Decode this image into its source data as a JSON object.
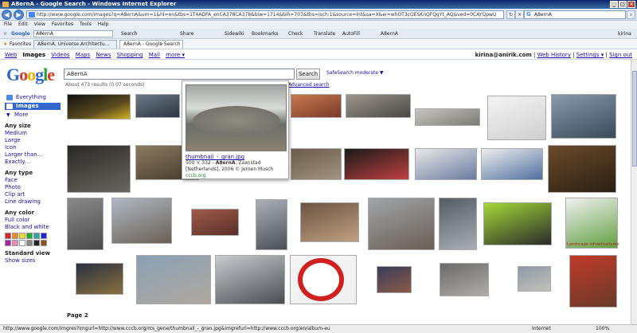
{
  "window": {
    "title": "A8ernA - Google Search - Windows Internet Explorer"
  },
  "addressbar": {
    "url": "http://www.google.com/images?q=A8ernA&um=1&hl=en&tbs=1T4ADFA_enCA378CA378&biw=1714&bih=707&tbs=isch:1&source=lnt&sa=X&ei=whOT3cOESKnQFQgYt_AQ&ved=0CAYQpwU",
    "search_value": "A8ernA",
    "search_engine": "Google"
  },
  "menu": [
    "File",
    "Edit",
    "View",
    "Favorites",
    "Tools",
    "Help"
  ],
  "toolbar": {
    "google_query": "A8ernA",
    "items": [
      "Search",
      "Share",
      "Sidewiki",
      "Bookmarks",
      "Check",
      "Translate",
      "AutoFill",
      "A8ernA"
    ],
    "account": "kirina"
  },
  "favorites": {
    "label": "Favorites",
    "tabs": [
      "A8ernA, Universe Architectu...",
      "A8ernA - Google Search"
    ]
  },
  "googlebar": {
    "left": [
      "Web",
      "Images",
      "Videos",
      "Maps",
      "News",
      "Shopping",
      "Mail",
      "more ▾"
    ],
    "current": "Images",
    "user": "kirina@anirik.com",
    "right": [
      "Web History",
      "Settings ▾",
      "Sign out"
    ]
  },
  "search": {
    "query": "A8ernA",
    "button": "Search",
    "safesearch": "SafeSearch moderate ▼",
    "stats": "About 473 results (0.07 seconds)",
    "advanced": "Advanced search"
  },
  "leftnav": {
    "types": [
      "Everything",
      "Images",
      "More"
    ],
    "size_heading": "Any size",
    "sizes": [
      "Medium",
      "Large",
      "Icon",
      "Larger than...",
      "Exactly..."
    ],
    "type_heading": "Any type",
    "type_opts": [
      "Face",
      "Photo",
      "Clip art",
      "Line drawing"
    ],
    "color_heading": "Any color",
    "color_opts": [
      "Full color",
      "Black and white"
    ],
    "swatch_colors": [
      "#dd2222",
      "#ee8822",
      "#eedd22",
      "#22aa22",
      "#22aaaa",
      "#2222dd",
      "#aa22aa",
      "#ee88bb",
      "#ffffff",
      "#888888",
      "#222222",
      "#885522"
    ],
    "view_heading": "Standard view",
    "view_opts": [
      "Show sizes"
    ]
  },
  "popup": {
    "link": "thumbnail_-_gran.jpg",
    "dims": "500 × 332 - ",
    "bold": "A8ernA",
    "rest": ". Zaanstad [Netherlands], 2006 © Jeroen Musch",
    "source": "cccb.org"
  },
  "thumbs_caption": "Landscape infrastructures",
  "pagination": {
    "label": "Page 2"
  },
  "status": {
    "url": "http://www.google.com/imgres?imgurl=http://www.cccb.org/rcs_gene/thumbnail_-_gran.jpg&imgrefurl=http://www.cccb.org/en/album-eu",
    "zone": "Internet",
    "zoom": "100%"
  }
}
